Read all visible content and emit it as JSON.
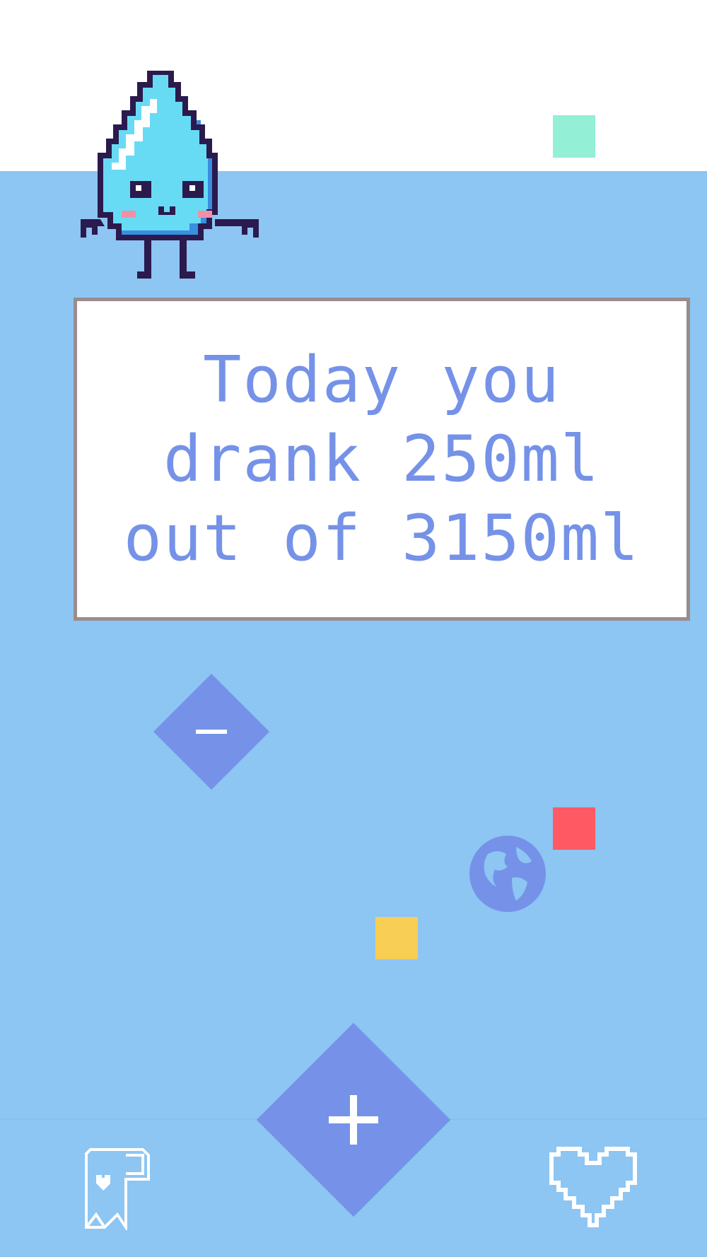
{
  "message": {
    "line1": "Today you",
    "line2": "drank 250ml",
    "line3": "out of 3150ml"
  },
  "intake": {
    "drank_ml": 250,
    "goal_ml": 3150
  },
  "buttons": {
    "decrease_label": "–",
    "increase_label": "+"
  },
  "icons": {
    "mascot": "water-drop-mascot-icon",
    "decrease": "minus-icon",
    "increase": "plus-icon",
    "globe": "globe-icon",
    "bookmark": "bookmark-heart-icon",
    "favorite": "heart-icon"
  },
  "colors": {
    "sky": "#8dc5f3",
    "accent": "#7592e8",
    "mint": "#93efd6",
    "red": "#ff5a64",
    "yellow": "#f8ce55",
    "box_border": "#9a8c8c"
  }
}
